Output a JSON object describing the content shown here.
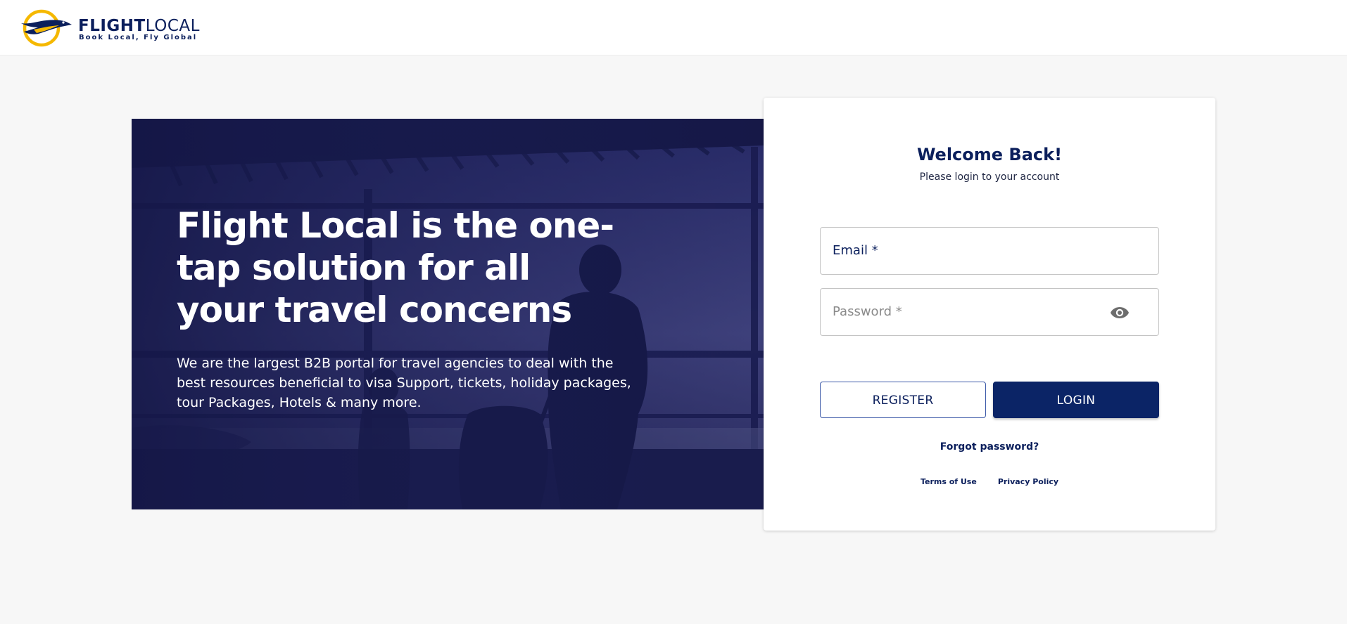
{
  "header": {
    "brand_bold": "FLIGHT",
    "brand_light": "LOCAL",
    "tagline": "Book Local, Fly Global",
    "logo_icon": "bird-logo-icon"
  },
  "hero": {
    "headline": "Flight Local is the one-tap solution for all your travel concerns",
    "body": "We are the largest B2B portal for travel agencies to deal with the best resources beneficial to visa Support, tickets, holiday packages, tour Packages, Hotels & many more."
  },
  "login": {
    "title": "Welcome Back!",
    "subtitle": "Please login to your account",
    "email_label": "Email *",
    "email_value": "",
    "password_label": "Password *",
    "password_value": "",
    "password_toggle_icon": "eye-icon",
    "register_label": "REGISTER",
    "login_label": "LOGIN",
    "forgot_label": "Forgot password?",
    "terms_label": "Terms of Use",
    "privacy_label": "Privacy Policy"
  },
  "colors": {
    "brand_navy": "#0b2466",
    "brand_yellow": "#f5b800",
    "hero_overlay": "#1d1f56",
    "page_bg": "#f7f7f7"
  }
}
